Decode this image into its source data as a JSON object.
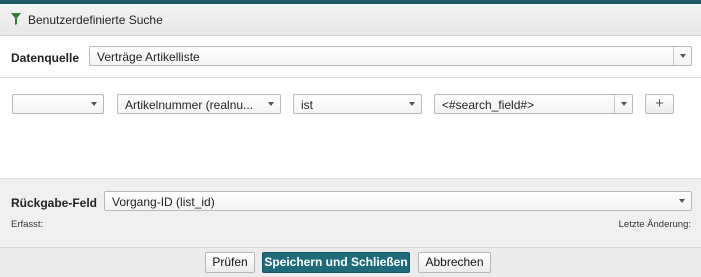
{
  "header": {
    "title": "Benutzerdefinierte Suche",
    "icon": "filter-icon"
  },
  "source": {
    "label": "Datenquelle",
    "value": "Verträge Artikelliste"
  },
  "criteria": {
    "row1": {
      "connector": "",
      "field": "Artikelnummer (realnu...",
      "operator": "ist",
      "value": "<#search_field#>"
    },
    "add_label": "+"
  },
  "return_field": {
    "label": "Rückgabe-Feld",
    "value": "Vorgang-ID (list_id)",
    "created_label": "Erfasst:",
    "modified_label": "Letzte Änderung:"
  },
  "footer": {
    "check_label": "Prüfen",
    "save_close_label": "Speichern und Schließen",
    "cancel_label": "Abbrechen"
  },
  "colors": {
    "accent": "#1f6b7c",
    "top_bar": "#1f5968",
    "filter_icon": "#2e7d32"
  }
}
